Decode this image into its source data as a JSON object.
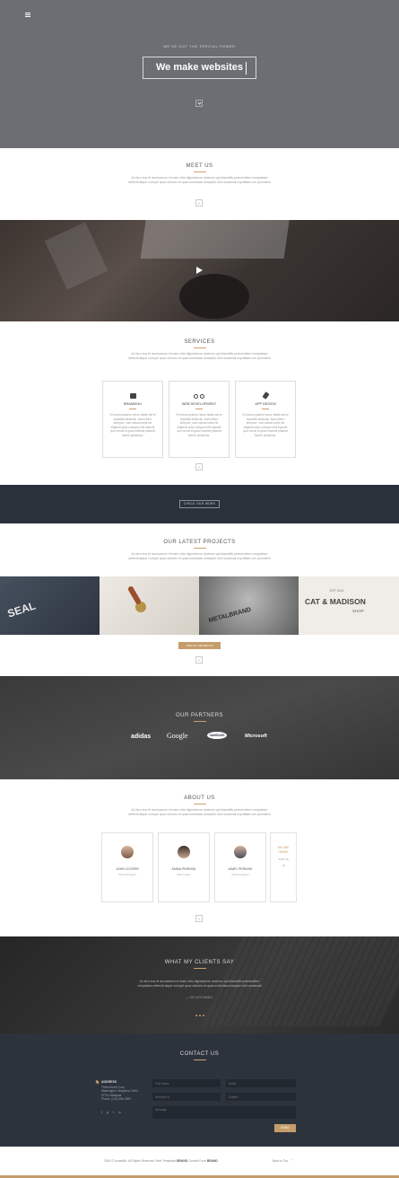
{
  "hero": {
    "menu_icon": "hamburger-icon",
    "kicker": "WE'VE GOT THE SPECIAL POWER",
    "title": "We make websites",
    "down_icon": "chevron-down-icon"
  },
  "meet": {
    "title": "MEET US",
    "text": "At vero eos et accusamus et iusto odio dignissimos ducimus qui blanditiis praesentium voluptatum deleniti atque corrupti quos dolores et quas molestias excepturi sint occaecati cupiditate non provident"
  },
  "video": {
    "play_icon": "play-icon"
  },
  "services": {
    "title": "SERVICES",
    "text": "At vero eos et accusamus et iusto odio dignissimos ducimus qui blanditiis praesentium voluptatum deleniti atque corrupti quos dolores et quas molestias excepturi sint occaecati cupiditate non provident",
    "cards": [
      {
        "icon": "book-icon",
        "title": "BRANDING",
        "text": "Et harum quidem rerum facilis est et expedita distinctio. Nam libero tempore, cum soluta nobis est eligendi optio cumque nihil impedit quo minus id quod maxime placeat facere possimus."
      },
      {
        "icon": "bicycle-icon",
        "title": "WEB DEVELOPMENT",
        "text": "Et harum quidem rerum facilis est et expedita distinctio. Nam libero tempore, cum soluta nobis est eligendi optio cumque nihil impedit quo minus id quod maxime placeat facere possimus."
      },
      {
        "icon": "plug-icon",
        "title": "APP DESIGN",
        "text": "Et harum quidem rerum facilis est et expedita distinctio. Nam libero tempore, cum soluta nobis est eligendi optio cumque nihil impedit quo minus id quod maxime placeat facere possimus."
      }
    ]
  },
  "cta": {
    "button": "CHECK OUR WORK"
  },
  "projects": {
    "title": "OUR LATEST PROJECTS",
    "text": "At vero eos et accusamus et iusto odio dignissimos ducimus qui blanditiis praesentium voluptatum deleniti atque corrupti quos dolores et quas molestias excepturi sint occaecati cupiditate non provident",
    "items": [
      {
        "label": "SEAL"
      },
      {
        "label": ""
      },
      {
        "label": "METALBRAND"
      },
      {
        "label": "CAT & MADISON",
        "badge": "EST",
        "year": "2014",
        "sub": "SHOP"
      }
    ],
    "button": "SEE ALL PROJECTS"
  },
  "partners": {
    "title": "OUR PARTNERS",
    "logos": [
      "adidas",
      "Google",
      "SAMSUNG",
      "Microsoft"
    ]
  },
  "about": {
    "title": "ABOUT US",
    "text": "At vero eos et accusamus et iusto odio dignissimos ducimus qui blanditiis praesentium voluptatum deleniti atque corrupti quos dolores et quas molestias excepturi sint occaecati cupiditate non provident",
    "team": [
      {
        "name": "JOHN COOPER",
        "role": "Web Designer"
      },
      {
        "name": "EMMA PERKINS",
        "role": "Web Coder"
      },
      {
        "name": "MARC PERKINS",
        "role": "Web Designer"
      }
    ],
    "join": {
      "text": "WE ARE HIRING",
      "sub": "JOIN US"
    }
  },
  "testimonials": {
    "title": "WHAT MY CLIENTS SAY",
    "quote": "At vero eos et accusamus et iusto odio dignissimos ducimus qui blanditiis praesentium voluptatum deleniti atque corrupti quos dolores et quas molestias excepturi sint occaecati",
    "author": "— JOE MCCONNELL"
  },
  "contact": {
    "title": "CONTACT US",
    "address_label": "ADDRESS",
    "address_lines": [
      "Themeforest Corp.",
      "Washington, Maryland, Delhi",
      "07702 Malaysia",
      "Phone: (123) 456-7890"
    ],
    "social_icons": [
      "facebook-icon",
      "google-plus-icon",
      "twitter-icon",
      "linkedin-icon"
    ],
    "fields": {
      "first_name": "First Name",
      "email": "Email",
      "security": "Security Nr.",
      "subject": "Subject",
      "message": "Message"
    },
    "send": "SEND"
  },
  "footer": {
    "copyright": "2015 © Armadillo. All Rights Reserved. Next Templates",
    "brand1": "BRAND",
    "brand2": "BRAND",
    "contact": "Contact Form",
    "back_to_top": "Back to Top"
  }
}
